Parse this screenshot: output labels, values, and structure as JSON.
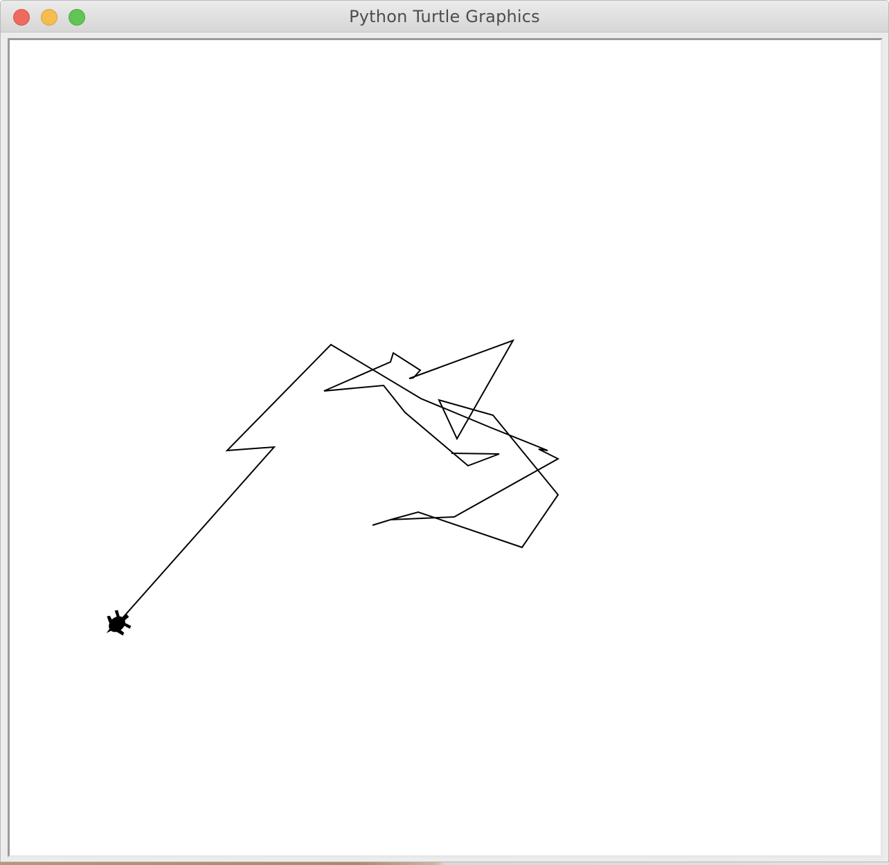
{
  "window": {
    "title": "Python Turtle Graphics"
  },
  "controls": {
    "close_color": "#ee6a5f",
    "minimize_color": "#f5bd4f",
    "zoom_color": "#61c454"
  },
  "canvas": {
    "background": "#ffffff",
    "pen_color": "#000000",
    "turtle_color": "#000000"
  }
}
